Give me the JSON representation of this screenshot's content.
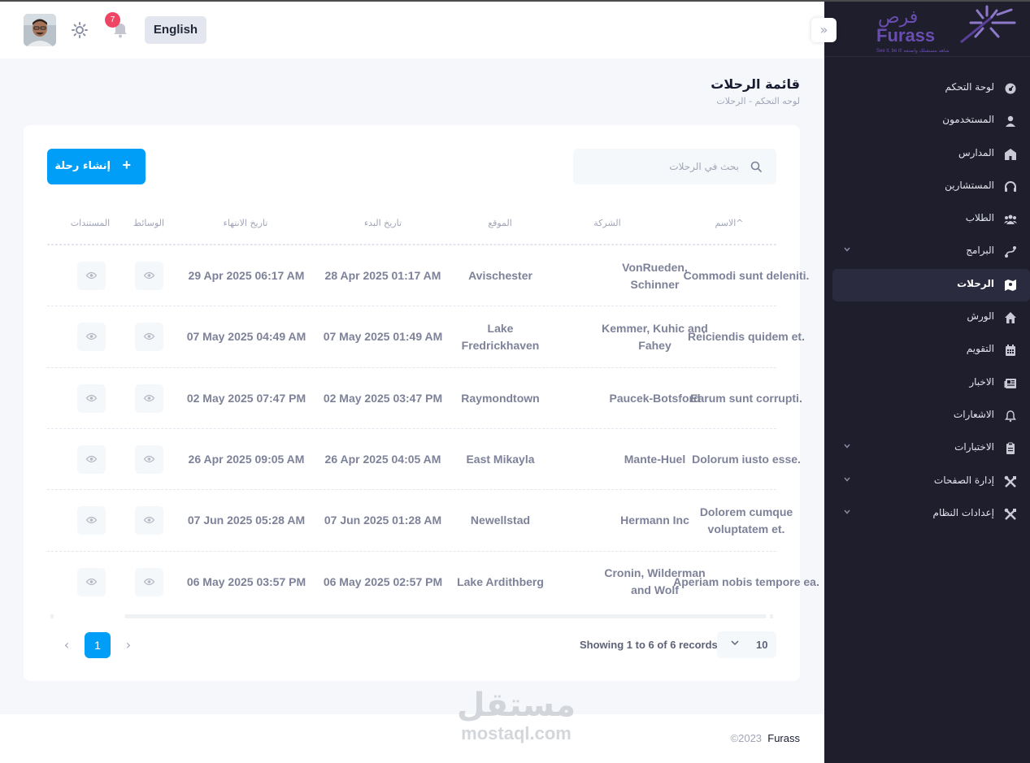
{
  "header": {
    "notification_count": "7",
    "language_label": "English"
  },
  "sidebar": {
    "logo": {
      "arabic": "فرص",
      "latin": "Furass",
      "tagline": "See it, be it!  شاهد مستقبلك واصنعه"
    },
    "items": [
      {
        "label": "لوحة التحكم",
        "icon": "dashboard-icon",
        "has_children": false,
        "active": false
      },
      {
        "label": "المستخدمون",
        "icon": "user-icon",
        "has_children": false,
        "active": false
      },
      {
        "label": "المدارس",
        "icon": "school-icon",
        "has_children": false,
        "active": false
      },
      {
        "label": "المستشارين",
        "icon": "headset-icon",
        "has_children": false,
        "active": false
      },
      {
        "label": "الطلاب",
        "icon": "users-icon",
        "has_children": false,
        "active": false
      },
      {
        "label": "البرامج",
        "icon": "route-icon",
        "has_children": true,
        "active": false
      },
      {
        "label": "الرحلات",
        "icon": "map-icon",
        "has_children": false,
        "active": true
      },
      {
        "label": "الورش",
        "icon": "home-icon",
        "has_children": false,
        "active": false
      },
      {
        "label": "التقويم",
        "icon": "calendar-icon",
        "has_children": false,
        "active": false
      },
      {
        "label": "الاخبار",
        "icon": "newspaper-icon",
        "has_children": false,
        "active": false
      },
      {
        "label": "الاشعارات",
        "icon": "bell-icon",
        "has_children": false,
        "active": false
      },
      {
        "label": "الاختبارات",
        "icon": "clipboard-icon",
        "has_children": true,
        "active": false
      },
      {
        "label": "إدارة الصفحات",
        "icon": "tools-icon",
        "has_children": true,
        "active": false
      },
      {
        "label": "إعدادات النظام",
        "icon": "tools-icon",
        "has_children": true,
        "active": false
      }
    ]
  },
  "page": {
    "title": "قائمة الرحلات",
    "breadcrumb": "لوحه التحكم  -  الرحلات"
  },
  "toolbar": {
    "create_label": "إنشاء رحلة",
    "search_placeholder": "بحث في الرحلات"
  },
  "table": {
    "columns": {
      "name": "الاسم^",
      "company": "الشركة",
      "location": "الموقع",
      "start": "تاريخ البدء",
      "end": "تاريخ الانتهاء",
      "media": "الوسائط",
      "documents": "المستندات"
    },
    "rows": [
      {
        "name": "Commodi sunt deleniti.",
        "company": "VonRueden, Schinner",
        "location": "Avischester",
        "start": "28 Apr 2025 01:17 AM",
        "end": "29 Apr 2025 06:17 AM"
      },
      {
        "name": "Reiciendis quidem et.",
        "company": "Kemmer, Kuhic and Fahey",
        "location": "Lake Fredrickhaven",
        "start": "07 May 2025 01:49 AM",
        "end": "07 May 2025 04:49 AM"
      },
      {
        "name": "Earum sunt corrupti.",
        "company": "Paucek-Botsford",
        "location": "Raymondtown",
        "start": "02 May 2025 03:47 PM",
        "end": "02 May 2025 07:47 PM"
      },
      {
        "name": "Dolorum iusto esse.",
        "company": "Mante-Huel",
        "location": "East Mikayla",
        "start": "26 Apr 2025 04:05 AM",
        "end": "26 Apr 2025 09:05 AM"
      },
      {
        "name": "Dolorem cumque voluptatem et.",
        "company": "Hermann Inc",
        "location": "Newellstad",
        "start": "07 Jun 2025 01:28 AM",
        "end": "07 Jun 2025 05:28 AM"
      },
      {
        "name": "Aperiam nobis tempore ea.",
        "company": "Cronin, Wilderman and Wolf",
        "location": "Lake Ardithberg",
        "start": "06 May 2025 02:57 PM",
        "end": "06 May 2025 03:57 PM"
      }
    ]
  },
  "pagination": {
    "records_text": "Showing 1 to 6 of 6 records",
    "per_page": "10",
    "current_page": "1",
    "prev": "‹",
    "next": "›"
  },
  "footer": {
    "year": "©2023",
    "brand": "Furass"
  },
  "watermark": {
    "arabic": "مستقل",
    "latin": "mostaql.com"
  },
  "colors": {
    "primary": "#009ef7",
    "sidebar_bg": "#1e1e2d",
    "badge": "#ef4565",
    "logo_purple": "#5b3f9b"
  }
}
